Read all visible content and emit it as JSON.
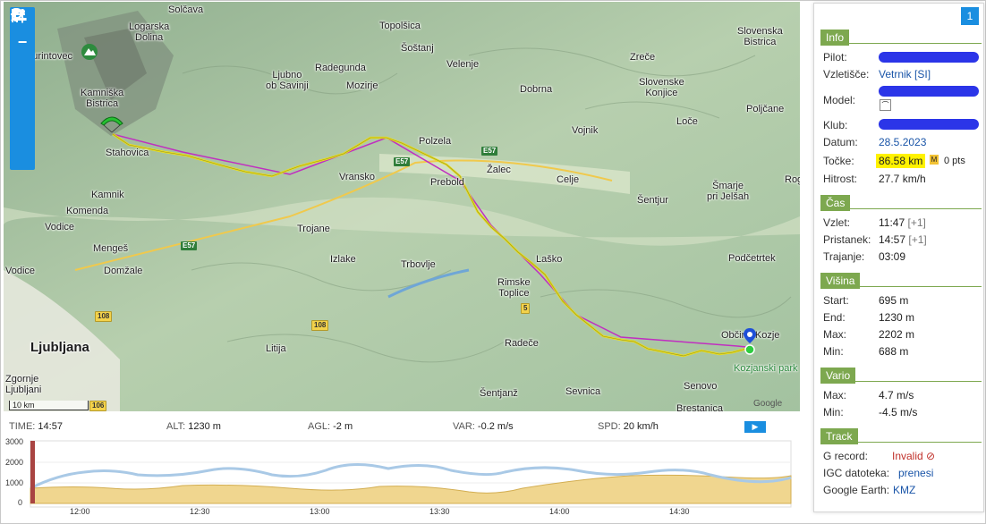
{
  "map": {
    "places": [
      {
        "name": "Solčava"
      },
      {
        "name": "Logarska\nDolina"
      },
      {
        "name": "Turintovec"
      },
      {
        "name": "Kamniška\nBistrica"
      },
      {
        "name": "Stahovica"
      },
      {
        "name": "Kamnik"
      },
      {
        "name": "Komenda"
      },
      {
        "name": "Vodice"
      },
      {
        "name": "Mengeš"
      },
      {
        "name": "Domžale"
      },
      {
        "name": "Vodice"
      },
      {
        "name": "Topolšica"
      },
      {
        "name": "Šoštanj"
      },
      {
        "name": "Velenje"
      },
      {
        "name": "Radegunda"
      },
      {
        "name": "Ljubno\nob Savinji"
      },
      {
        "name": "Mozirje"
      },
      {
        "name": "Dobrna"
      },
      {
        "name": "Vojnik"
      },
      {
        "name": "Polzela"
      },
      {
        "name": "Žalec"
      },
      {
        "name": "Celje"
      },
      {
        "name": "Prebold"
      },
      {
        "name": "Vransko"
      },
      {
        "name": "Trojane"
      },
      {
        "name": "Izlake"
      },
      {
        "name": "Trbovlje"
      },
      {
        "name": "Laško"
      },
      {
        "name": "Rimske\nToplice"
      },
      {
        "name": "Šentjur"
      },
      {
        "name": "Litija"
      },
      {
        "name": "Radeče"
      },
      {
        "name": "Šentjanž"
      },
      {
        "name": "Sevnica"
      },
      {
        "name": "Senovo"
      },
      {
        "name": "Brestanica"
      },
      {
        "name": "Slovenska\nBistrica"
      },
      {
        "name": "Zreče"
      },
      {
        "name": "Slovenske\nKonjice"
      },
      {
        "name": "Poljčane"
      },
      {
        "name": "Loče"
      },
      {
        "name": "Šmarje\npri Jelšah"
      },
      {
        "name": "Podčetrtek"
      },
      {
        "name": "Občina Kozje"
      },
      {
        "name": "Kozjanski park"
      },
      {
        "name": "Zgornje\nLjubljani"
      },
      {
        "name": "Ljubljana"
      },
      {
        "name": "Rog"
      }
    ],
    "roads": [
      "E57",
      "E57",
      "E57",
      "108",
      "108",
      "106",
      "5"
    ],
    "scale": "10 km",
    "attribution": "Google",
    "controls": [
      "zoom-in",
      "zoom-out",
      "location",
      "pin",
      "flight",
      "flag",
      "people"
    ]
  },
  "status": {
    "time_label": "TIME:",
    "time": "14:57",
    "alt_label": "ALT:",
    "alt": "1230 m",
    "agl_label": "AGL:",
    "agl": "-2 m",
    "var_label": "VAR:",
    "var": "-0.2 m/s",
    "spd_label": "SPD:",
    "spd": "20 km/h"
  },
  "graph": {
    "y_ticks": [
      "3000",
      "2000",
      "1000",
      "0"
    ],
    "x_ticks": [
      "12:00",
      "12:30",
      "13:00",
      "13:30",
      "14:00",
      "14:30"
    ],
    "ylim": [
      0,
      3000
    ],
    "altitude_color": "#a9c9e6",
    "ground_color": "#f0d68f"
  },
  "panel": {
    "badge": "1",
    "info": {
      "title": "Info",
      "pilot_label": "Pilot:",
      "launch_label": "Vzletišče:",
      "launch_value": "Vetrnik [SI]",
      "model_label": "Model:",
      "club_label": "Klub:",
      "date_label": "Datum:",
      "date_value": "28.5.2023",
      "points_label": "Točke:",
      "distance_value": "86.58 km",
      "points_value": "0 pts",
      "speed_label": "Hitrost:",
      "speed_value": "27.7 km/h"
    },
    "time": {
      "title": "Čas",
      "takeoff_label": "Vzlet:",
      "takeoff_value": "11:47",
      "takeoff_tz": "[+1]",
      "landing_label": "Pristanek:",
      "landing_value": "14:57",
      "landing_tz": "[+1]",
      "duration_label": "Trajanje:",
      "duration_value": "03:09"
    },
    "height": {
      "title": "Višina",
      "start_label": "Start:",
      "start_value": "695 m",
      "end_label": "End:",
      "end_value": "1230 m",
      "max_label": "Max:",
      "max_value": "2202 m",
      "min_label": "Min:",
      "min_value": "688 m"
    },
    "vario": {
      "title": "Vario",
      "max_label": "Max:",
      "max_value": "4.7 m/s",
      "min_label": "Min:",
      "min_value": "-4.5 m/s"
    },
    "track": {
      "title": "Track",
      "g_label": "G record:",
      "g_value": "Invalid",
      "igc_label": "IGC datoteka:",
      "igc_value": "prenesi",
      "ge_label": "Google Earth:",
      "ge_value": "KMZ"
    }
  }
}
